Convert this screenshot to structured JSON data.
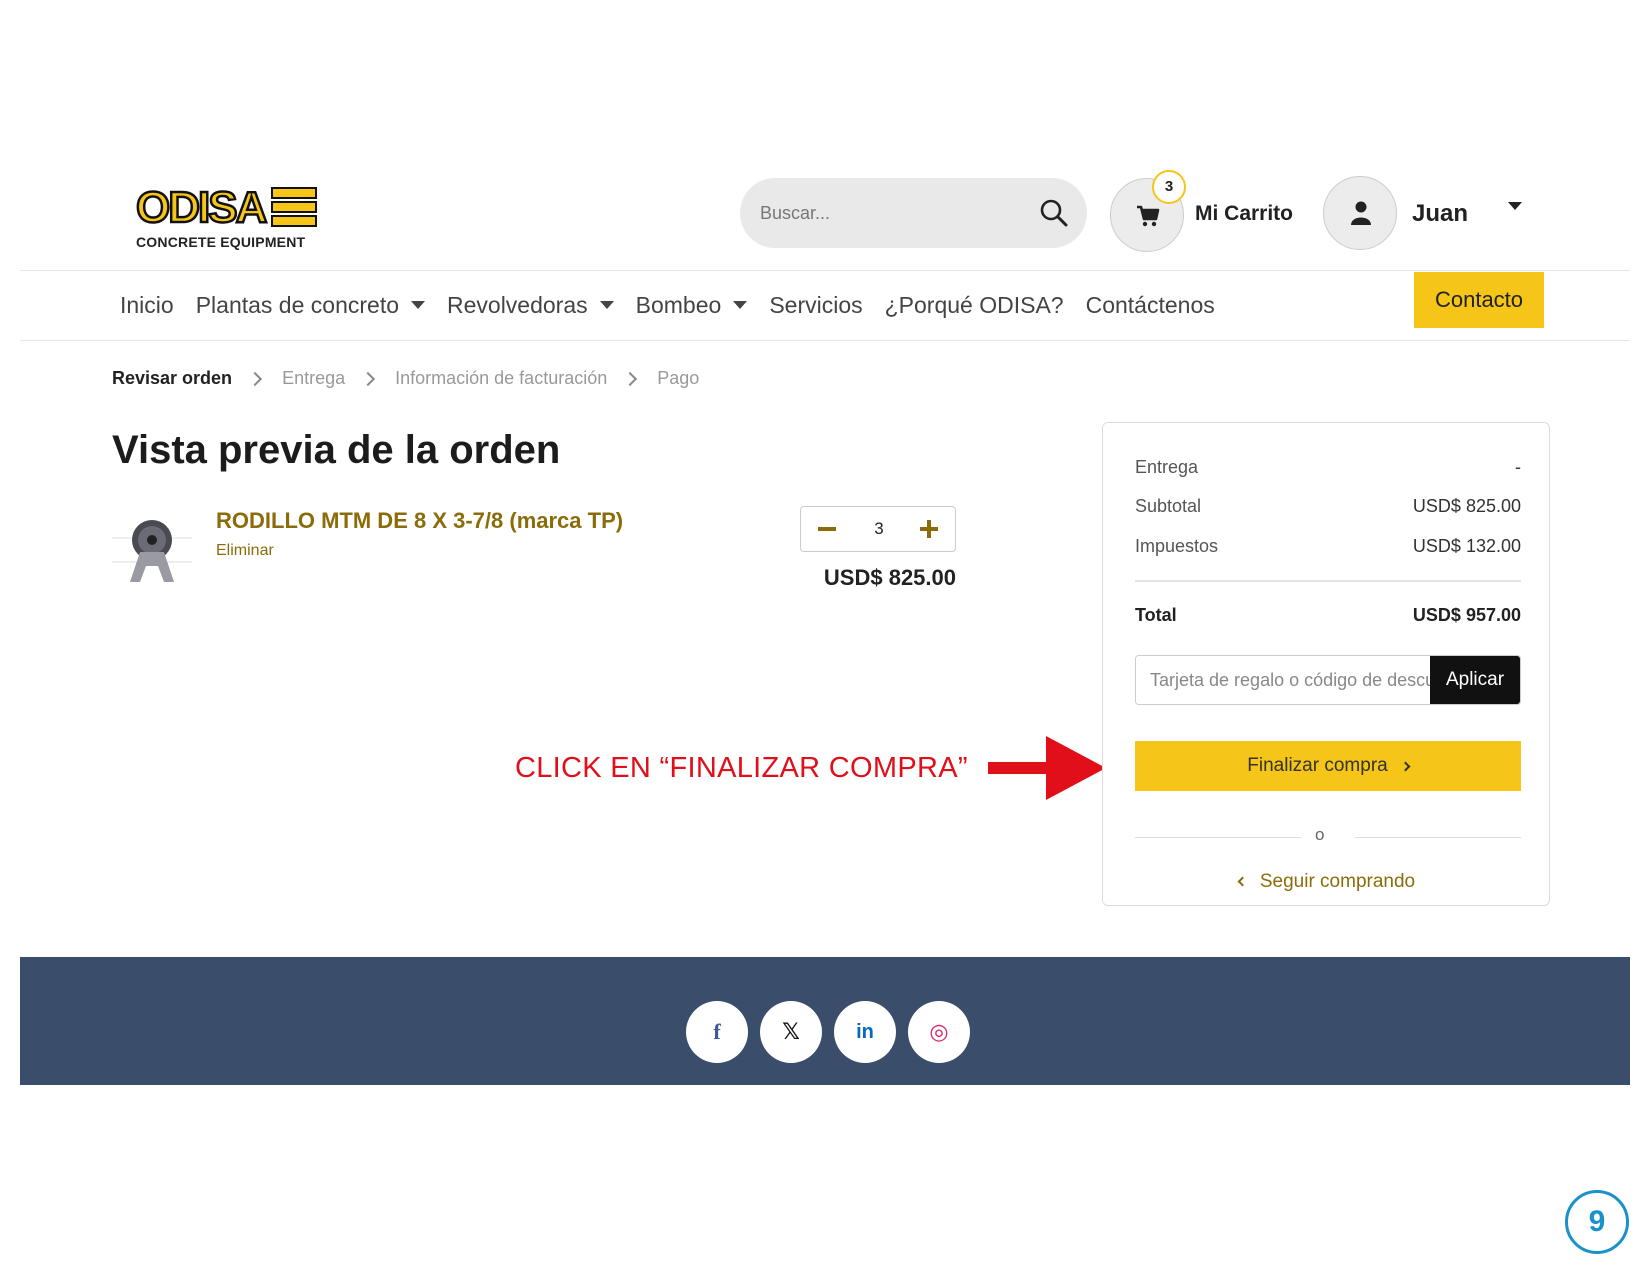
{
  "brand": {
    "logo_text": "ODISA",
    "tagline": "CONCRETE EQUIPMENT",
    "colors": {
      "yellow": "#f5c518",
      "gold_text": "#8a6d0a",
      "footer": "#3a4e6b",
      "annotation": "#e00f1a",
      "page_badge": "#1a91c9"
    }
  },
  "header": {
    "search_placeholder": "Buscar...",
    "search_icon": "search-icon",
    "cart": {
      "count": "3",
      "label": "Mi Carrito",
      "icon": "cart-icon"
    },
    "user": {
      "name": "Juan",
      "icon": "user-icon"
    }
  },
  "nav": {
    "items": [
      {
        "label": "Inicio"
      },
      {
        "label": "Plantas de concreto"
      },
      {
        "label": "Revolvedoras"
      },
      {
        "label": "Bombeo"
      },
      {
        "label": "Servicios"
      },
      {
        "label": "¿Porqué ODISA?"
      },
      {
        "label": "Contáctenos"
      }
    ],
    "contact_button": "Contacto"
  },
  "breadcrumb": [
    "Revisar orden",
    "Entrega",
    "Información de facturación",
    "Pago"
  ],
  "page_title": "Vista previa de la orden",
  "product": {
    "name": "RODILLO MTM DE 8 X 3-7/8 (marca TP)",
    "remove": "Eliminar",
    "quantity": "3",
    "price": "USD$ 825.00"
  },
  "summary": {
    "entrega_label": "Entrega",
    "entrega_value": "-",
    "subtotal_label": "Subtotal",
    "subtotal_value": "USD$ 825.00",
    "impuestos_label": "Impuestos",
    "impuestos_value": "USD$ 132.00",
    "total_label": "Total",
    "total_value": "USD$ 957.00",
    "coupon_placeholder": "Tarjeta de regalo o código de descuento",
    "apply": "Aplicar",
    "checkout": "Finalizar compra",
    "or": "o",
    "keep_shopping": "Seguir comprando"
  },
  "annotation": "CLICK EN “FINALIZAR COMPRA”",
  "footer": {
    "socials": [
      {
        "icon": "facebook-icon",
        "glyph": "f",
        "color": "#3b5998"
      },
      {
        "icon": "x-icon",
        "glyph": "𝕏",
        "color": "#111111"
      },
      {
        "icon": "linkedin-icon",
        "glyph": "in",
        "color": "#0a66c2"
      },
      {
        "icon": "instagram-icon",
        "glyph": "◎",
        "color": "#d6246e"
      }
    ]
  },
  "page_number": "9"
}
